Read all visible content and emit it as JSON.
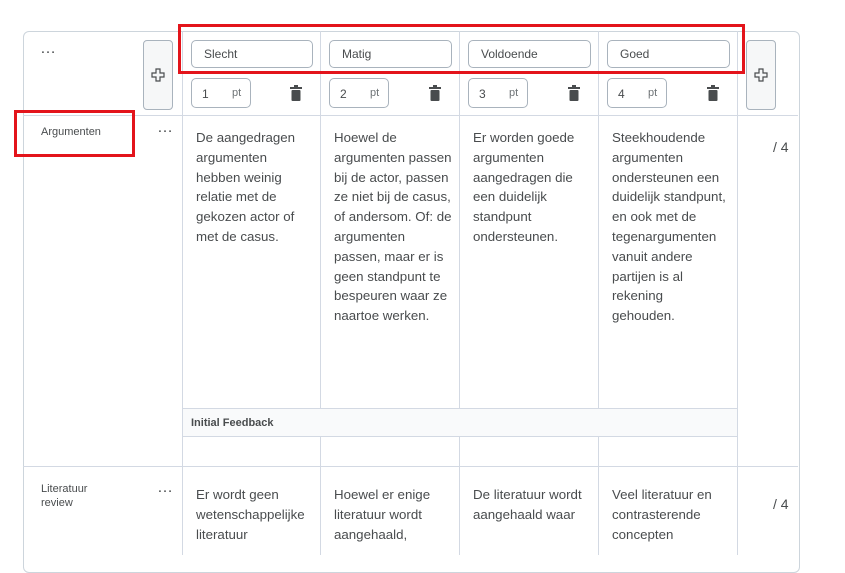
{
  "header": {
    "levels": [
      {
        "name": "Slecht",
        "points": "1"
      },
      {
        "name": "Matig",
        "points": "2"
      },
      {
        "name": "Voldoende",
        "points": "3"
      },
      {
        "name": "Goed",
        "points": "4"
      }
    ],
    "points_unit": "pt",
    "more_label": "…"
  },
  "criteria": [
    {
      "name": "Argumenten",
      "more": "…",
      "descriptions": [
        "De aangedragen argumenten hebben weinig relatie met de gekozen actor of met de casus.",
        "Hoewel de argumenten passen bij de actor, passen ze niet bij de casus, of andersom. Of: de argumenten passen, maar er is geen standpunt te bespeuren waar ze naartoe werken.",
        "Er worden goede argumenten aangedragen die een duidelijk standpunt ondersteunen.",
        "Steekhoudende argumenten ondersteunen een duidelijk standpunt, en ook met de tegenargumenten vanuit andere partijen is al rekening gehouden."
      ],
      "score": "/ 4",
      "feedback_label": "Initial Feedback"
    },
    {
      "name": "Literatuur review",
      "more": "…",
      "descriptions": [
        "Er wordt geen wetenschappelijke literatuur",
        "Hoewel er enige literatuur wordt aangehaald,",
        "De literatuur wordt aangehaald waar",
        "Veel literatuur en contrasterende concepten"
      ],
      "score": "/ 4"
    }
  ],
  "colors": {
    "highlight": "#e3141b",
    "border": "#d3d9e3",
    "text": "#494c4e"
  }
}
